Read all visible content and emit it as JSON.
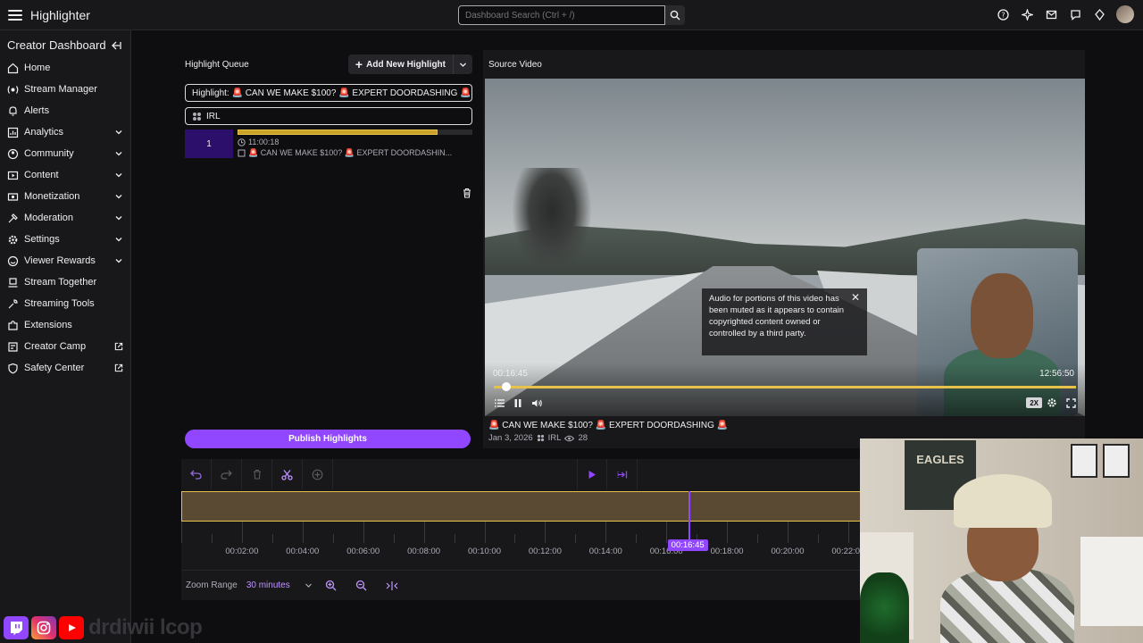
{
  "app": {
    "title": "Highlighter"
  },
  "search": {
    "placeholder": "Dashboard Search (Ctrl + /)"
  },
  "sidebar": {
    "title": "Creator Dashboard",
    "items": [
      {
        "label": "Home",
        "icon": "home-icon",
        "chevron": false,
        "external": false
      },
      {
        "label": "Stream Manager",
        "icon": "stream-manager-icon",
        "chevron": false,
        "external": false
      },
      {
        "label": "Alerts",
        "icon": "bell-icon",
        "chevron": false,
        "external": false
      },
      {
        "label": "Analytics",
        "icon": "analytics-icon",
        "chevron": true,
        "external": false
      },
      {
        "label": "Community",
        "icon": "community-icon",
        "chevron": true,
        "external": false
      },
      {
        "label": "Content",
        "icon": "content-icon",
        "chevron": true,
        "external": false
      },
      {
        "label": "Monetization",
        "icon": "monetization-icon",
        "chevron": true,
        "external": false
      },
      {
        "label": "Moderation",
        "icon": "moderation-icon",
        "chevron": true,
        "external": false
      },
      {
        "label": "Settings",
        "icon": "gear-icon",
        "chevron": true,
        "external": false
      },
      {
        "label": "Viewer Rewards",
        "icon": "rewards-icon",
        "chevron": true,
        "external": false
      },
      {
        "label": "Stream Together",
        "icon": "stream-together-icon",
        "chevron": false,
        "external": false
      },
      {
        "label": "Streaming Tools",
        "icon": "tools-icon",
        "chevron": false,
        "external": false
      },
      {
        "label": "Extensions",
        "icon": "extensions-icon",
        "chevron": false,
        "external": false
      },
      {
        "label": "Creator Camp",
        "icon": "creator-camp-icon",
        "chevron": false,
        "external": true
      },
      {
        "label": "Safety Center",
        "icon": "shield-icon",
        "chevron": false,
        "external": true
      }
    ]
  },
  "queue": {
    "title": "Highlight Queue",
    "add_label": "Add New Highlight",
    "title_field": "Highlight: 🚨 CAN WE MAKE $100? 🚨 EXPERT DOORDASHING 🚨",
    "category_field": "IRL",
    "items": [
      {
        "number": "1",
        "time": "11:00:18",
        "title": "🚨 CAN WE MAKE $100? 🚨 EXPERT DOORDASHIN...",
        "progress": 0.85
      }
    ],
    "publish_label": "Publish Highlights"
  },
  "video": {
    "panel_title": "Source Video",
    "muted_notice": "Audio for portions of this video has been muted as it appears to contain copyrighted content owned or controlled by a third party.",
    "current_time": "00:16:45",
    "duration": "12:56:50",
    "progress": 0.022,
    "speed": "2X",
    "title": "🚨 CAN WE MAKE $100? 🚨 EXPERT DOORDASHING 🚨",
    "date": "Jan 3, 2026",
    "category": "IRL",
    "views": "28"
  },
  "timeline": {
    "ticks": [
      "00:02:00",
      "00:04:00",
      "00:06:00",
      "00:08:00",
      "00:10:00",
      "00:12:00",
      "00:14:00",
      "00:16:00",
      "00:18:00",
      "00:20:00",
      "00:22:00"
    ],
    "playhead_time": "00:16:45",
    "zoom_label": "Zoom Range",
    "zoom_value": "30 minutes"
  },
  "overlay": {
    "poster_text": "EAGLES",
    "handle": "drdiwii lcop"
  },
  "colors": {
    "accent": "#9147ff",
    "clip": "#e6c24a"
  }
}
